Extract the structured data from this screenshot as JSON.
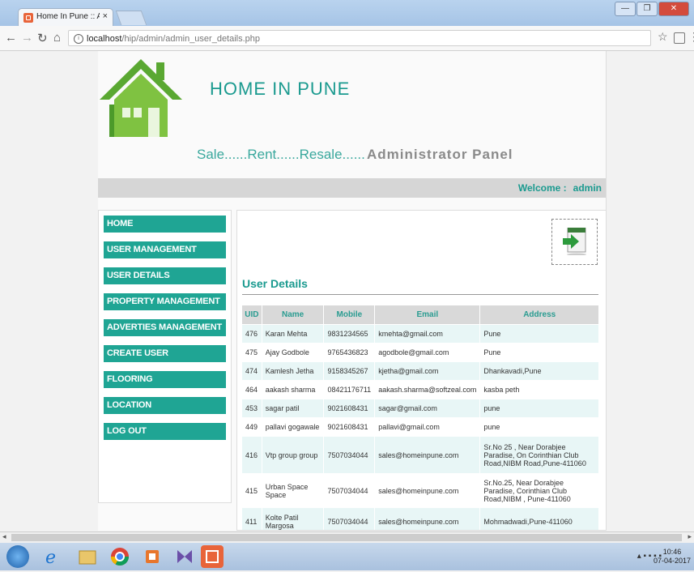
{
  "browser": {
    "tab_title": "Home In Pune :: Adminis",
    "tab_close": "×",
    "url_host": "localhost",
    "url_path": "/hip/admin/admin_user_details.php"
  },
  "header": {
    "site_title": "HOME IN PUNE",
    "tagline": "Sale......Rent......Resale......",
    "panel_title": "Administrator Panel",
    "welcome_label": "Welcome :",
    "welcome_user": "admin"
  },
  "sidebar": {
    "items": [
      {
        "label": "HOME"
      },
      {
        "label": "USER MANAGEMENT"
      },
      {
        "label": "USER DETAILS"
      },
      {
        "label": "PROPERTY MANAGEMENT"
      },
      {
        "label": "ADVERTIES MANAGEMENT"
      },
      {
        "label": "CREATE USER"
      },
      {
        "label": "FLOORING"
      },
      {
        "label": "LOCATION"
      },
      {
        "label": "LOG OUT"
      }
    ]
  },
  "main": {
    "section_title": "User Details",
    "columns": [
      "UID",
      "Name",
      "Mobile",
      "Email",
      "Address"
    ],
    "rows": [
      {
        "uid": "476",
        "name": "Karan Mehta",
        "mobile": "9831234565",
        "email": "kmehta@gmail.com",
        "address": "Pune"
      },
      {
        "uid": "475",
        "name": "Ajay Godbole",
        "mobile": "9765436823",
        "email": "agodbole@gmail.com",
        "address": "Pune"
      },
      {
        "uid": "474",
        "name": "Kamlesh Jetha",
        "mobile": "9158345267",
        "email": "kjetha@gmail.com",
        "address": "Dhankavadi,Pune"
      },
      {
        "uid": "464",
        "name": "aakash sharma",
        "mobile": "08421176711",
        "email": "aakash.sharma@softzeal.com",
        "address": "kasba peth"
      },
      {
        "uid": "453",
        "name": "sagar patil",
        "mobile": "9021608431",
        "email": "sagar@gmail.com",
        "address": "pune"
      },
      {
        "uid": "449",
        "name": "pallavi gogawale",
        "mobile": "9021608431",
        "email": "pallavi@gmail.com",
        "address": "pune"
      },
      {
        "uid": "416",
        "name": "Vtp group group",
        "mobile": "7507034044",
        "email": "sales@homeinpune.com",
        "address": "Sr.No 25 , Near Dorabjee Paradise, On Corinthian Club Road,NIBM Road,Pune-411060"
      },
      {
        "uid": "415",
        "name": "Urban Space Space",
        "mobile": "7507034044",
        "email": "sales@homeinpune.com",
        "address": "Sr.No.25, Near Dorabjee Paradise, Corinthian Club Road,NIBM , Pune-411060"
      },
      {
        "uid": "411",
        "name": "Kolte Patil Margosa",
        "mobile": "7507034044",
        "email": "sales@homeinpune.com",
        "address": "Mohmadwadi,Pune-411060"
      }
    ]
  },
  "taskbar": {
    "time": "10:46",
    "date": "07-04-2017"
  },
  "colors": {
    "accent": "#1fa594",
    "title_text": "#1a9a8f"
  }
}
